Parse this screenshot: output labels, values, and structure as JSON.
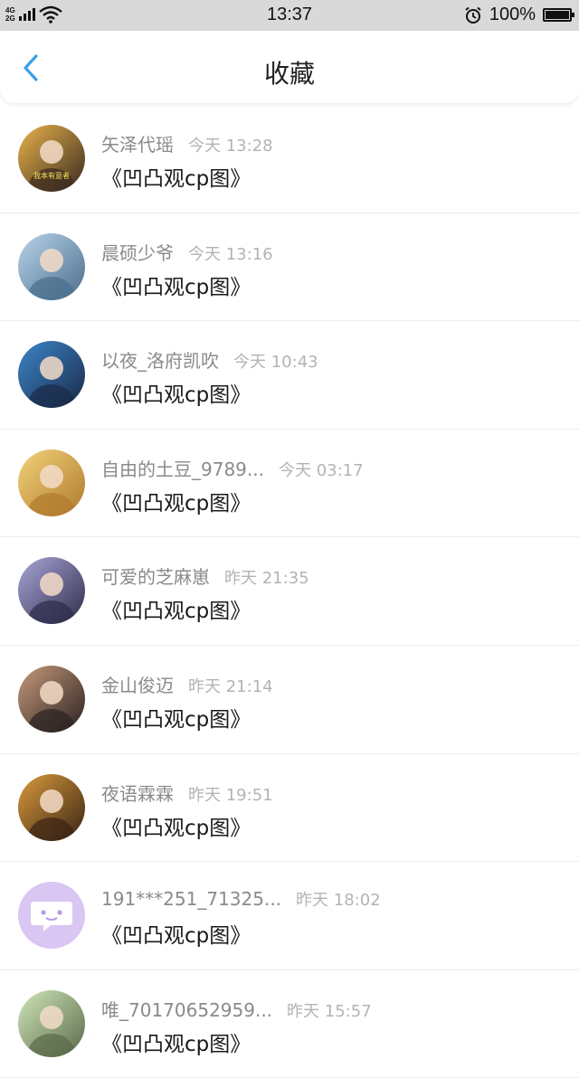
{
  "status_bar": {
    "network_top": "4G",
    "network_bottom": "2G",
    "time": "13:37",
    "battery": "100%"
  },
  "header": {
    "title": "收藏",
    "back_icon": "chevron-left-icon",
    "accent_color": "#3a9fe8"
  },
  "items": [
    {
      "name": "矢泽代瑶",
      "time": "今天 13:28",
      "title": "《凹凸观cp图》",
      "avatar_colors": [
        "#e8b34a",
        "#3a2a20"
      ],
      "avatar_caption": "我本有意者"
    },
    {
      "name": "晨硕少爷",
      "time": "今天 13:16",
      "title": "《凹凸观cp图》",
      "avatar_colors": [
        "#b8d4ea",
        "#4a6d8c"
      ]
    },
    {
      "name": "以夜_洛府凯吹",
      "time": "今天 10:43",
      "title": "《凹凸观cp图》",
      "avatar_colors": [
        "#3c86c9",
        "#1a2a48"
      ]
    },
    {
      "name": "自由的土豆_9789...",
      "time": "今天 03:17",
      "title": "《凹凸观cp图》",
      "avatar_colors": [
        "#f2d27a",
        "#b07a2c"
      ]
    },
    {
      "name": "可爱的芝麻崽",
      "time": "昨天 21:35",
      "title": "《凹凸观cp图》",
      "avatar_colors": [
        "#a9a6d8",
        "#2e2c4a"
      ]
    },
    {
      "name": "金山俊迈",
      "time": "昨天 21:14",
      "title": "《凹凸观cp图》",
      "avatar_colors": [
        "#c69a7a",
        "#2a2222"
      ]
    },
    {
      "name": "夜语霖霖",
      "time": "昨天 19:51",
      "title": "《凹凸观cp图》",
      "avatar_colors": [
        "#d99a3c",
        "#3a2414"
      ]
    },
    {
      "name": "191***251_71325...",
      "time": "昨天 18:02",
      "title": "《凹凸观cp图》",
      "avatar_colors": [
        "#d9c6f2",
        "#ffffff"
      ]
    },
    {
      "name": "唯_70170652959...",
      "time": "昨天 15:57",
      "title": "《凹凸观cp图》",
      "avatar_colors": [
        "#cfe6b8",
        "#5a6a4a"
      ]
    }
  ]
}
